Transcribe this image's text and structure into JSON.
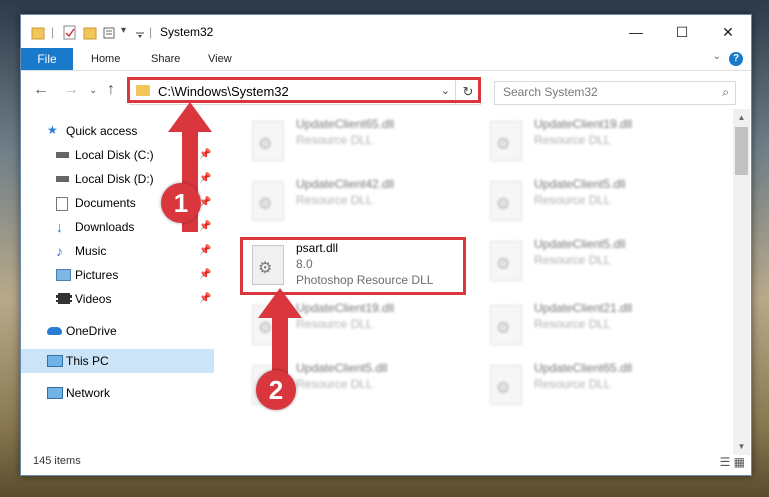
{
  "window": {
    "title": "System32",
    "quick_access_dropdown": "▾"
  },
  "ribbon": {
    "tabs": [
      "File",
      "Home",
      "Share",
      "View"
    ]
  },
  "address": {
    "path": "C:\\Windows\\System32"
  },
  "search": {
    "placeholder": "Search System32"
  },
  "sidebar": {
    "items": [
      {
        "label": "Quick access",
        "icon": "star-icon",
        "pinned": false
      },
      {
        "label": "Local Disk (C:)",
        "icon": "drive-icon",
        "pinned": true
      },
      {
        "label": "Local Disk (D:)",
        "icon": "drive-icon",
        "pinned": true
      },
      {
        "label": "Documents",
        "icon": "documents-icon",
        "pinned": true
      },
      {
        "label": "Downloads",
        "icon": "downloads-icon",
        "pinned": true
      },
      {
        "label": "Music",
        "icon": "music-icon",
        "pinned": true
      },
      {
        "label": "Pictures",
        "icon": "pictures-icon",
        "pinned": true
      },
      {
        "label": "Videos",
        "icon": "videos-icon",
        "pinned": true
      },
      {
        "label": "OneDrive",
        "icon": "onedrive-icon",
        "pinned": false
      },
      {
        "label": "This PC",
        "icon": "pc-icon",
        "pinned": false,
        "selected": true
      },
      {
        "label": "Network",
        "icon": "network-icon",
        "pinned": false
      }
    ]
  },
  "files": [
    {
      "name": "UpdateClient65.dll",
      "type": "Resource DLL"
    },
    {
      "name": "UpdateClient19.dll",
      "type": "Resource DLL"
    },
    {
      "name": "UpdateClient42.dll",
      "type": "Resource DLL"
    },
    {
      "name": "UpdateClient5.dll",
      "type": "Resource DLL"
    },
    {
      "name": "psart.dll",
      "version": "8.0",
      "type": "Photoshop Resource DLL"
    },
    {
      "name": "UpdateClient5.dll",
      "type": "Resource DLL"
    },
    {
      "name": "UpdateClient19.dll",
      "type": "Resource DLL"
    },
    {
      "name": "UpdateClient21.dll",
      "type": "Resource DLL"
    },
    {
      "name": "UpdateClient5.dll",
      "type": "Resource DLL"
    },
    {
      "name": "UpdateClient65.dll",
      "type": "Resource DLL"
    }
  ],
  "status": {
    "item_count": "145 items"
  },
  "annotations": {
    "badge1": "1",
    "badge2": "2",
    "color": "#d9363e"
  }
}
